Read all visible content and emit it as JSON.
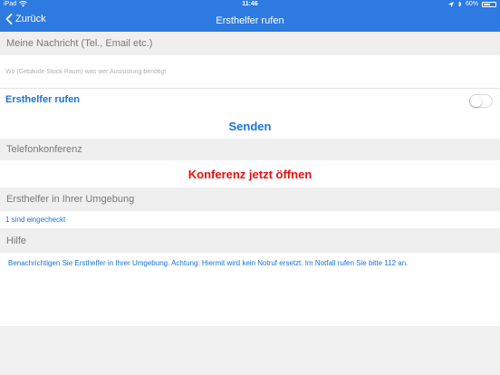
{
  "statusbar": {
    "device": "iPad",
    "time": "11:46",
    "battery_text": "60%",
    "battery_level": 0.6
  },
  "navbar": {
    "back_label": "Zurück",
    "title": "Ersthelfer rufen"
  },
  "message_section": {
    "header": "Meine Nachricht (Tel., Email etc.)",
    "input_placeholder": "Wo (Gebäude Stock Raum) was wer Ausrüstung benötigt",
    "input_value": ""
  },
  "call_helper": {
    "label": "Ersthelfer rufen",
    "enabled": false
  },
  "send_button": "Senden",
  "conference_section": {
    "header": "Telefonkonferenz",
    "button": "Konferenz jetzt öffnen"
  },
  "nearby_section": {
    "header": "Ersthelfer in Ihrer Umgebung",
    "status": "1 sind eingecheckt"
  },
  "help_section": {
    "header": "Hilfe",
    "text": "Benachrichtigen Sie Ersthelfer in Ihrer Umgebung. Achtung: Hiermit wird kein Notruf ersetzt. Im Notfall rufen Sie bitte 112 an."
  },
  "colors": {
    "accent": "#2d7ae0",
    "link_blue": "#1a73d9",
    "danger_red": "#e81010",
    "section_bg": "#efefef"
  },
  "icons": [
    "wifi-icon",
    "location-arrow-icon",
    "bluetooth-icon",
    "battery-icon",
    "chevron-left-icon"
  ]
}
